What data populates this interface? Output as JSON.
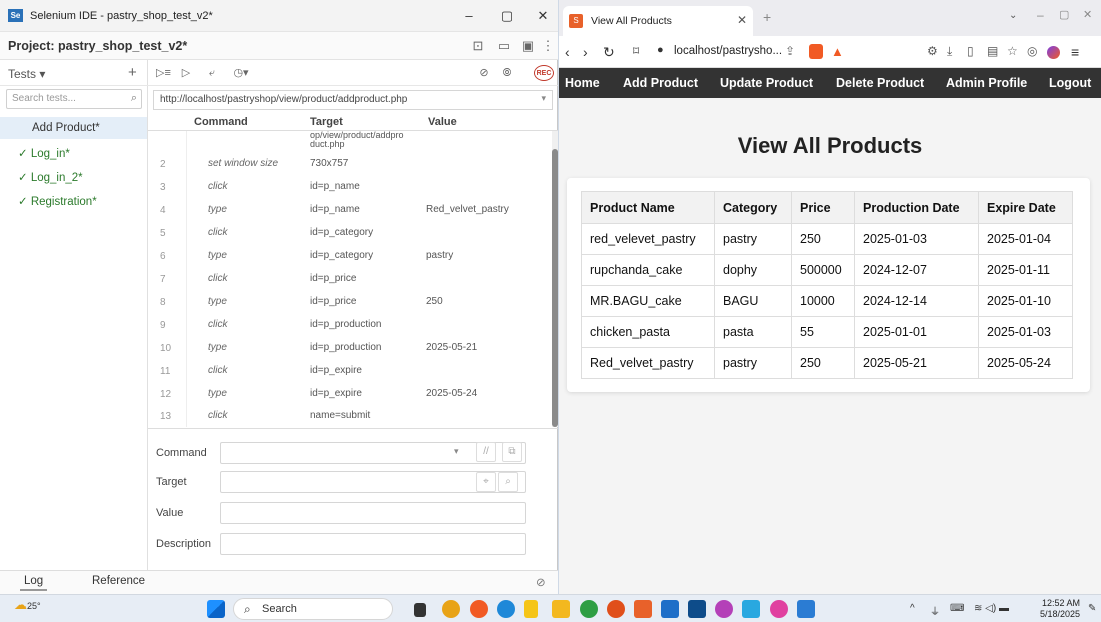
{
  "selenium": {
    "window_title": "Selenium IDE - pastry_shop_test_v2*",
    "window_controls": [
      "–",
      "▢",
      "✕"
    ],
    "project_label": "Project: pastry_shop_test_v2*",
    "tests_dropdown": "Tests ▾",
    "add_test": "+",
    "search_placeholder": "Search tests...",
    "tests": [
      {
        "name": "Add Product*",
        "selected": true
      },
      {
        "name": "✓ Log_in*",
        "selected": false
      },
      {
        "name": "✓ Log_in_2*",
        "selected": false
      },
      {
        "name": "✓ Registration*",
        "selected": false
      }
    ],
    "base_url": "http://localhost/pastryshop/view/product/addproduct.php",
    "columns": {
      "command": "Command",
      "target": "Target",
      "value": "Value"
    },
    "first_row_target": [
      "op/view/product/addpro",
      "duct.php"
    ],
    "rows": [
      {
        "n": "2",
        "command": "set window size",
        "target": "730x757",
        "value": ""
      },
      {
        "n": "3",
        "command": "click",
        "target": "id=p_name",
        "value": ""
      },
      {
        "n": "4",
        "command": "type",
        "target": "id=p_name",
        "value": "Red_velvet_pastry"
      },
      {
        "n": "5",
        "command": "click",
        "target": "id=p_category",
        "value": ""
      },
      {
        "n": "6",
        "command": "type",
        "target": "id=p_category",
        "value": "pastry"
      },
      {
        "n": "7",
        "command": "click",
        "target": "id=p_price",
        "value": ""
      },
      {
        "n": "8",
        "command": "type",
        "target": "id=p_price",
        "value": "250"
      },
      {
        "n": "9",
        "command": "click",
        "target": "id=p_production",
        "value": ""
      },
      {
        "n": "10",
        "command": "type",
        "target": "id=p_production",
        "value": "2025-05-21"
      },
      {
        "n": "11",
        "command": "click",
        "target": "id=p_expire",
        "value": ""
      },
      {
        "n": "12",
        "command": "type",
        "target": "id=p_expire",
        "value": "2025-05-24"
      },
      {
        "n": "13",
        "command": "click",
        "target": "name=submit",
        "value": ""
      }
    ],
    "editor": {
      "command_label": "Command",
      "target_label": "Target",
      "value_label": "Value",
      "description_label": "Description"
    },
    "bottom_tabs": {
      "log": "Log",
      "reference": "Reference"
    }
  },
  "browser": {
    "tab_title": "View All Products",
    "url": "localhost/pastrysho...",
    "nav": [
      "Home",
      "Add Product",
      "Update Product",
      "Delete Product",
      "Admin Profile",
      "Logout"
    ],
    "page_title": "View All Products",
    "table": {
      "headers": [
        "Product Name",
        "Category",
        "Price",
        "Production Date",
        "Expire Date"
      ],
      "rows": [
        [
          "red_velevet_pastry",
          "pastry",
          "250",
          "2025-01-03",
          "2025-01-04"
        ],
        [
          "rupchanda_cake",
          "dophy",
          "500000",
          "2024-12-07",
          "2025-01-11"
        ],
        [
          "MR.BAGU_cake",
          "BAGU",
          "10000",
          "2024-12-14",
          "2025-01-10"
        ],
        [
          "chicken_pasta",
          "pasta",
          "55",
          "2025-01-01",
          "2025-01-03"
        ],
        [
          "Red_velvet_pastry",
          "pastry",
          "250",
          "2025-05-21",
          "2025-05-24"
        ]
      ]
    }
  },
  "taskbar": {
    "weather": "25°",
    "search_label": "Search",
    "time": "12:52 AM",
    "date": "5/18/2025"
  }
}
